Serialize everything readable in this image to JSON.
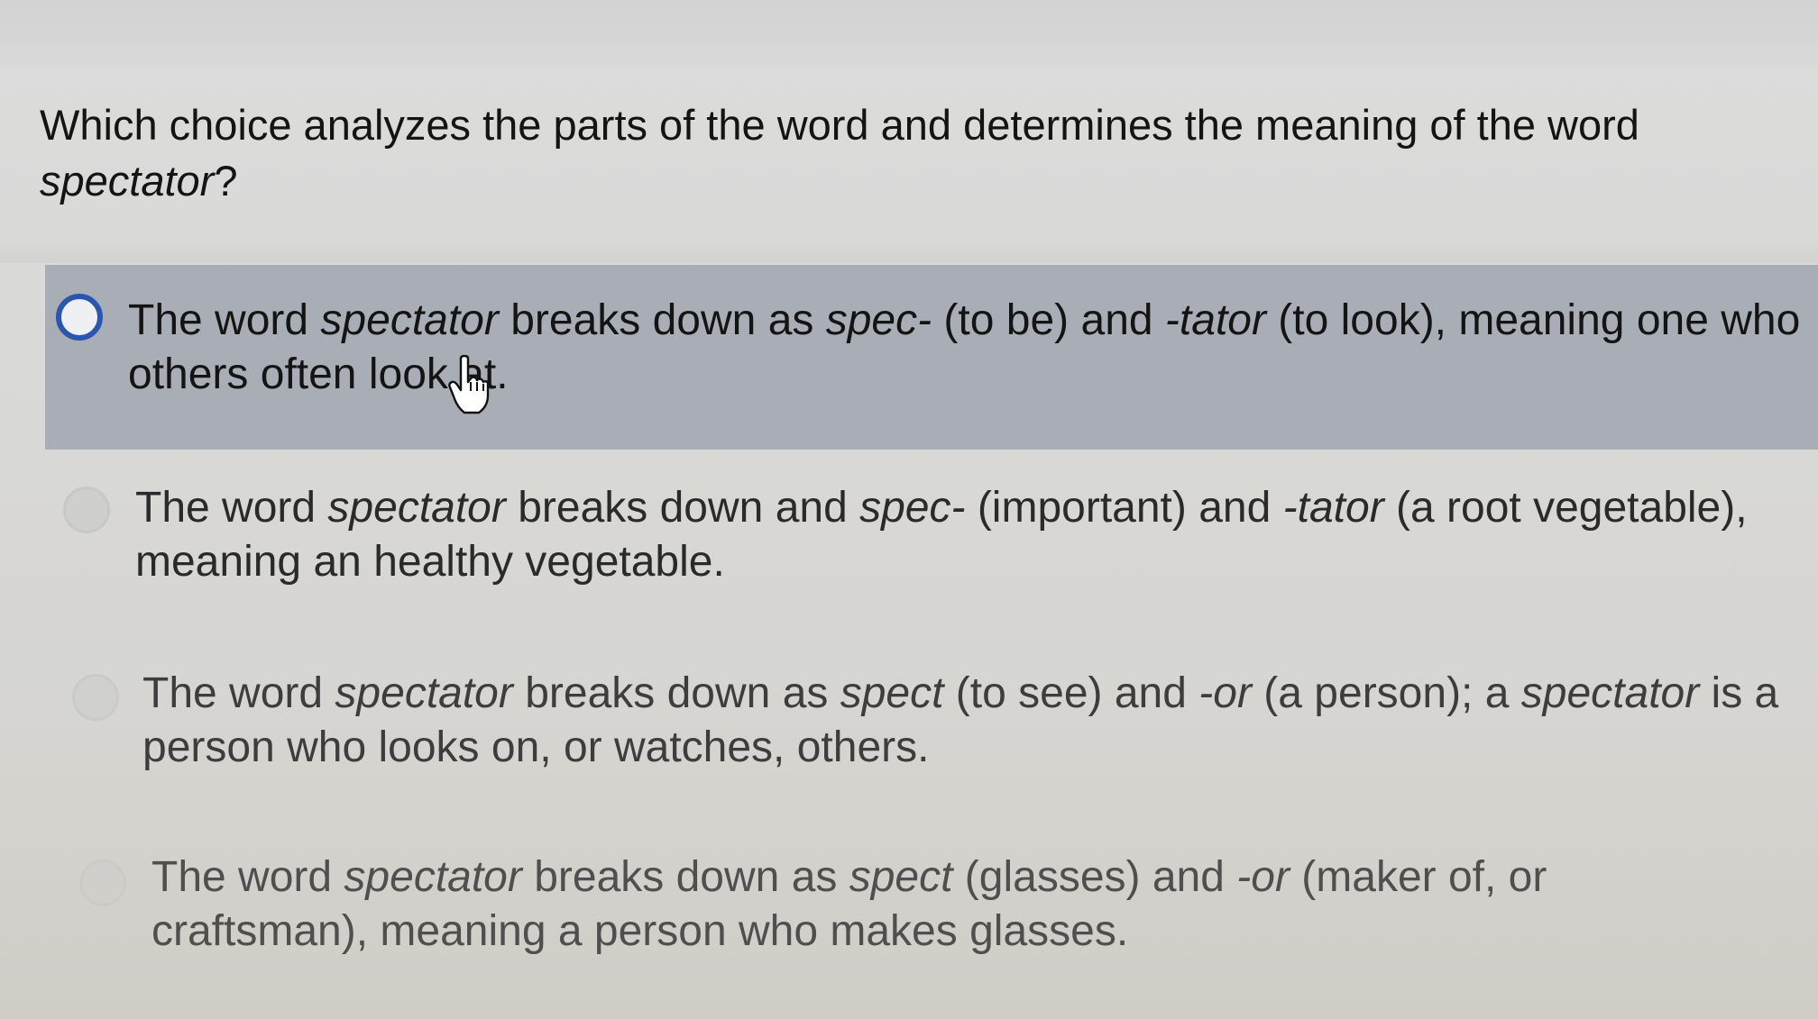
{
  "question": {
    "text_before": "Which choice analyzes the parts of the word and determines the meaning of the word ",
    "word": "spectator",
    "text_after": "?"
  },
  "choices": [
    {
      "selected": true,
      "p1": "The word ",
      "i1": "spectator",
      "p2": " breaks down as ",
      "i2": "spec-",
      "p3": " (to be) and ",
      "i3": "-tator",
      "p4": " (to look), meaning one who others often look at."
    },
    {
      "selected": false,
      "p1": "The word ",
      "i1": "spectator",
      "p2": " breaks down and ",
      "i2": "spec-",
      "p3": " (important) and ",
      "i3": "-tator",
      "p4": " (a root vegetable), meaning an healthy vegetable."
    },
    {
      "selected": false,
      "p1": "The word ",
      "i1": "spectator",
      "p2": " breaks down as ",
      "i2": "spect",
      "p3": " (to see) and ",
      "i3": "-or",
      "p4": " (a person); a ",
      "i4": "spectator",
      "p5": " is a person who looks on, or watches, others."
    },
    {
      "selected": false,
      "p1": "The word ",
      "i1": "spectator",
      "p2": " breaks down as ",
      "i2": "spect",
      "p3": " (glasses) and ",
      "i3": "-or",
      "p4": " (maker of, or craftsman), meaning a person who makes glasses."
    }
  ],
  "colors": {
    "selected_background": "#a9adb5",
    "radio_selected": "#2a56b0"
  },
  "icons": {
    "cursor": "hand-pointer-icon"
  }
}
